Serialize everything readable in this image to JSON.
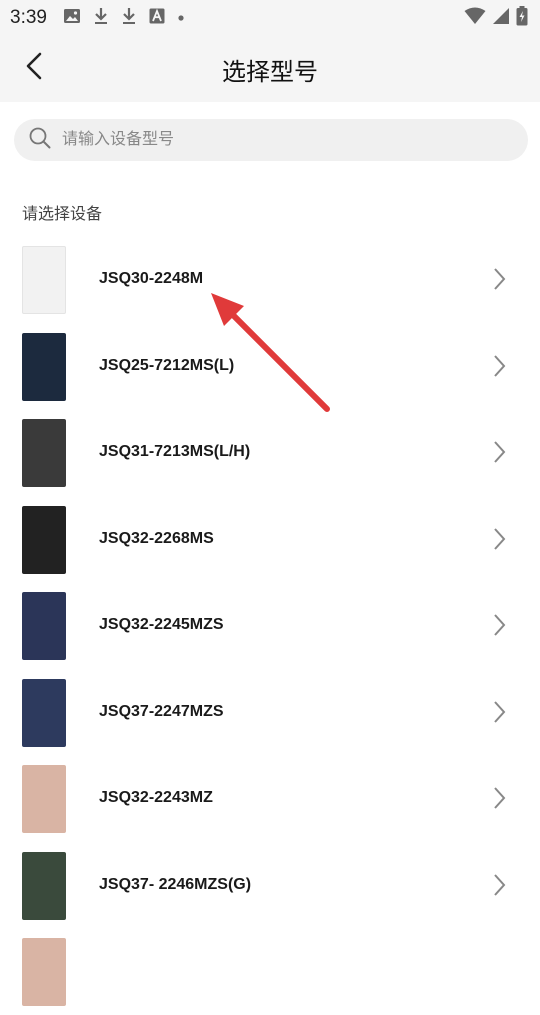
{
  "status_bar": {
    "time": "3:39",
    "icons": [
      "image-icon",
      "download-icon",
      "download-icon",
      "text-a-icon",
      "dot-icon",
      "wifi-icon",
      "signal-icon",
      "battery-icon"
    ]
  },
  "header": {
    "title": "选择型号",
    "back_icon": "chevron-left-icon"
  },
  "search": {
    "placeholder": "请输入设备型号",
    "value": ""
  },
  "section_label": "请选择设备",
  "devices": [
    {
      "name": "JSQ30-2248M",
      "color": "#f2f2f2"
    },
    {
      "name": "JSQ25-7212MS(L)",
      "color": "#1c2a3e"
    },
    {
      "name": "JSQ31-7213MS(L/H)",
      "color": "#3a3a3a"
    },
    {
      "name": "JSQ32-2268MS",
      "color": "#222222"
    },
    {
      "name": "JSQ32-2245MZS",
      "color": "#2b3558"
    },
    {
      "name": "JSQ37-2247MZS",
      "color": "#2d3a5e"
    },
    {
      "name": "JSQ32-2243MZ",
      "color": "#d9b4a4"
    },
    {
      "name": "JSQ37- 2246MZS(G)",
      "color": "#3a4a3c"
    },
    {
      "name": "",
      "color": "#d9b4a4"
    }
  ],
  "annotation": {
    "arrow_color": "#e03a3a"
  }
}
